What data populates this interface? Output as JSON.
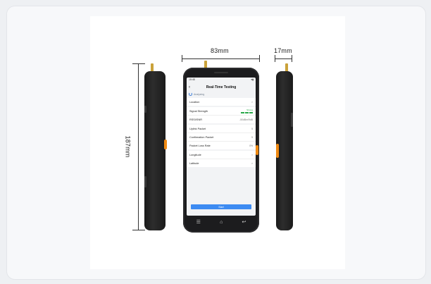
{
  "dimensions": {
    "width_label": "83mm",
    "depth_label": "17mm",
    "height_label": "187mm"
  },
  "screen": {
    "status_time": "15:48",
    "title": "Real-Time Testing",
    "status_text": "Analyzing",
    "rows": [
      {
        "label": "Location",
        "value": ">"
      },
      {
        "label": "Signal Strength",
        "value": "Strong"
      },
      {
        "label": "RSSI/SNR",
        "value": "-50dBm/9dB"
      },
      {
        "label": "Uplink Packet",
        "value": "5"
      },
      {
        "label": "Confirmation Packet",
        "value": "5"
      },
      {
        "label": "Packet Loss Rate",
        "value": "0%"
      },
      {
        "label": "Longitude",
        "value": ">"
      },
      {
        "label": "Latitude",
        "value": ">"
      }
    ],
    "start_button": "Start"
  },
  "colors": {
    "accent": "#3d8bf2",
    "signal": "#2aa84a",
    "orange_key": "#f08a12",
    "antenna": "#caa23a"
  },
  "icons": {
    "nav": [
      "menu-icon",
      "home-icon",
      "back-arrow-icon"
    ]
  }
}
